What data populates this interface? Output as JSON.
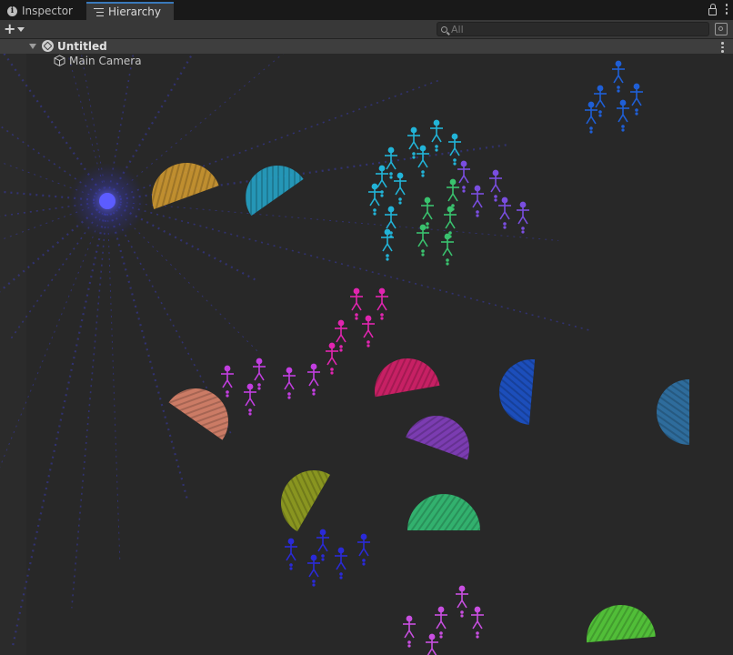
{
  "tabs": [
    {
      "label": "Inspector",
      "icon": "info-icon",
      "active": false
    },
    {
      "label": "Hierarchy",
      "icon": "hierarchy-lines-icon",
      "active": true
    }
  ],
  "toolbar": {
    "add_label": "+",
    "search": {
      "placeholder": "All",
      "value": ""
    }
  },
  "tree": {
    "scene": {
      "name": "Untitled",
      "icon": "unity-scene-icon",
      "expanded": true
    },
    "items": [
      {
        "name": "Main Camera",
        "icon": "gameobject-cube-icon"
      }
    ]
  },
  "colors": {
    "accent_tab": "#3a79bb",
    "panel_bg": "#282828",
    "blobs": [
      "#d9a030",
      "#25a9cf",
      "#e88a70",
      "#e31e6e",
      "#1a55d5",
      "#2f78b0",
      "#8a3fc9",
      "#9aa81e",
      "#34c97a",
      "#58d83b"
    ],
    "figures": [
      "#1f5fd6",
      "#22b4d8",
      "#3ac26e",
      "#7a4ee0",
      "#e125b0",
      "#c23ee0",
      "#2a2ad8",
      "#c84fe0"
    ]
  }
}
